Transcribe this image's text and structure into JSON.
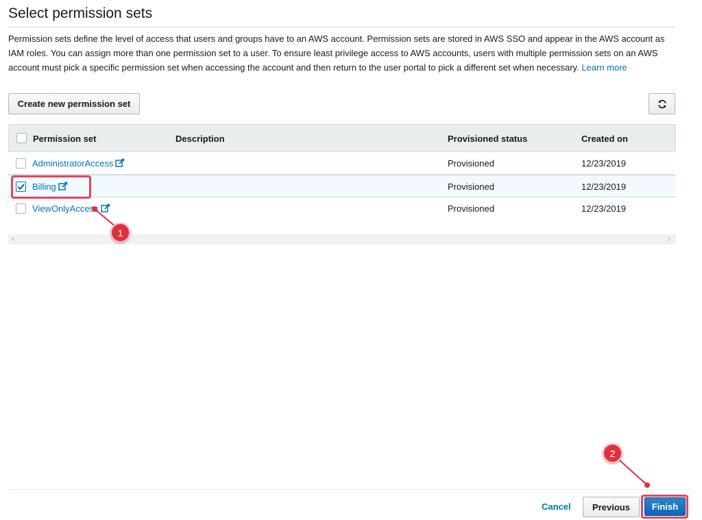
{
  "header": {
    "title": "Select permission sets"
  },
  "description": {
    "text": "Permission sets define the level of access that users and groups have to an AWS account. Permission sets are stored in AWS SSO and appear in the AWS account as IAM roles. You can assign more than one permission set to a user. To ensure least privilege access to AWS accounts, users with multiple permission sets on an AWS account must pick a specific permission set when accessing the account and then return to the user portal to pick a different set when necessary.",
    "learn_more": "Learn more"
  },
  "toolbar": {
    "create_label": "Create new permission set",
    "refresh_icon": "refresh-icon"
  },
  "table": {
    "columns": {
      "permission_set": "Permission set",
      "description": "Description",
      "provisioned_status": "Provisioned status",
      "created_on": "Created on"
    },
    "rows": [
      {
        "name": "AdministratorAccess",
        "description": "",
        "status": "Provisioned",
        "created": "12/23/2019",
        "checked": false
      },
      {
        "name": "Billing",
        "description": "",
        "status": "Provisioned",
        "created": "12/23/2019",
        "checked": true
      },
      {
        "name": "ViewOnlyAccess",
        "description": "",
        "status": "Provisioned",
        "created": "12/23/2019",
        "checked": false
      }
    ]
  },
  "footer": {
    "cancel_label": "Cancel",
    "previous_label": "Previous",
    "finish_label": "Finish"
  },
  "annotations": {
    "step1": "1",
    "step2": "2",
    "highlight_color": "#e8415c",
    "badge_color": "#e0303d"
  },
  "colors": {
    "link": "#0073bb",
    "primary_button": "#0a66b8",
    "header_bg": "#eaeded"
  }
}
